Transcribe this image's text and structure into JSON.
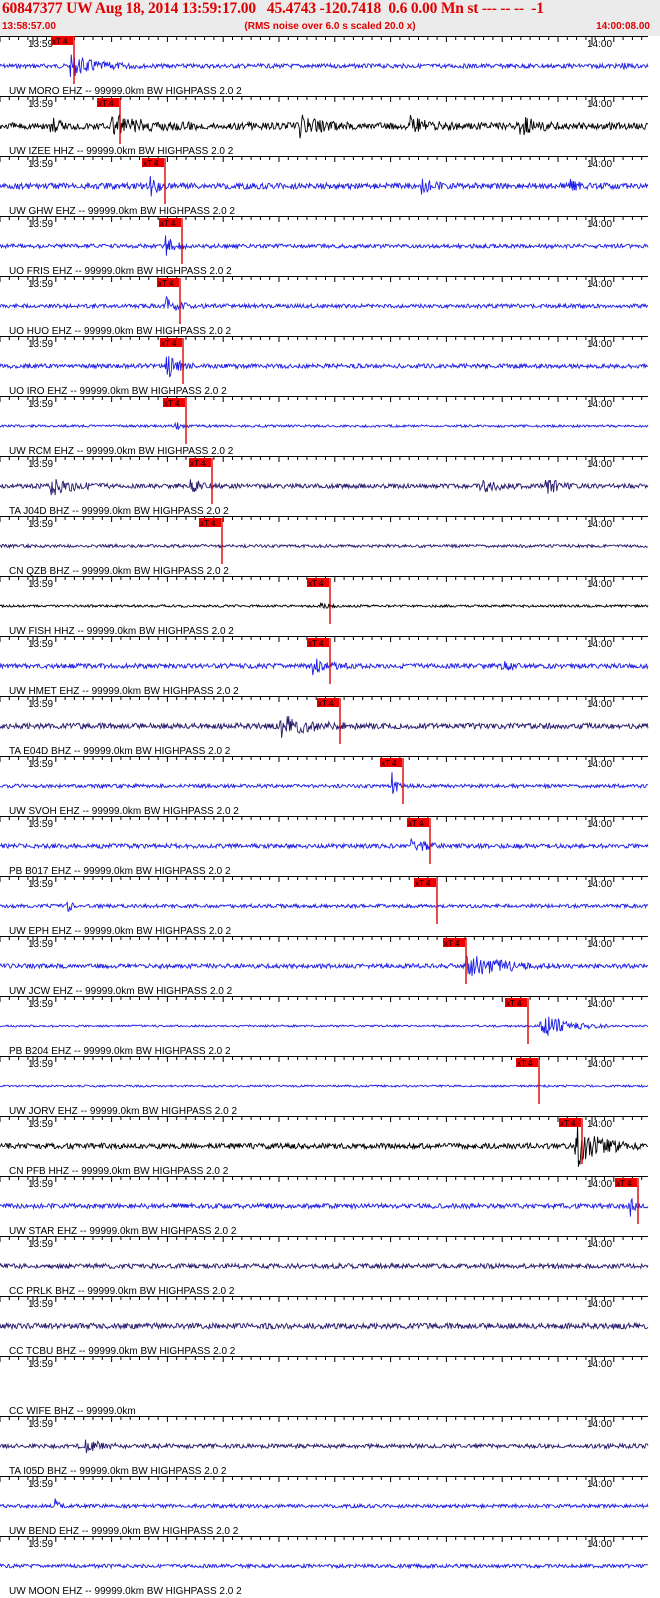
{
  "header": {
    "title": "60847377 UW Aug 18, 2014 13:59:17.00   45.4743 -120.7418  0.6 0.00 Mn st --- -- --  -1",
    "start_time": "13:58:57.00",
    "end_time": "14:00:08.00",
    "rms_note": "(RMS noise over 6.0 s scaled 20.0 x)"
  },
  "tick_labels": {
    "first": "13:59",
    "second": "14:00"
  },
  "pick_label": "xT 4",
  "colors": {
    "blue": "#1e1ee6",
    "black": "#000000",
    "purple": "#2a1a6e",
    "red": "#e00000",
    "pick_bg": "#ee0000"
  },
  "traces": [
    {
      "label": "UW MORO EHZ -- 99999.0km BW  HIGHPASS  2.0  2",
      "color": "blue"
    },
    {
      "label": "UW IZEE HHZ -- 99999.0km BW  HIGHPASS  2.0  2",
      "color": "black"
    },
    {
      "label": "UW GHW EHZ -- 99999.0km BW  HIGHPASS  2.0  2",
      "color": "blue"
    },
    {
      "label": "UO FRIS EHZ -- 99999.0km BW  HIGHPASS  2.0  2",
      "color": "blue"
    },
    {
      "label": "UO HUO EHZ -- 99999.0km BW  HIGHPASS  2.0  2",
      "color": "blue"
    },
    {
      "label": "UO IRO EHZ -- 99999.0km BW  HIGHPASS  2.0  2",
      "color": "blue"
    },
    {
      "label": "UW RCM EHZ -- 99999.0km BW  HIGHPASS  2.0  2",
      "color": "blue"
    },
    {
      "label": "TA J04D BHZ -- 99999.0km BW  HIGHPASS  2.0  2",
      "color": "purple"
    },
    {
      "label": "CN QZB BHZ -- 99999.0km BW  HIGHPASS  2.0  2",
      "color": "purple"
    },
    {
      "label": "UW FISH HHZ -- 99999.0km BW  HIGHPASS  2.0  2",
      "color": "black"
    },
    {
      "label": "UW HMET EHZ -- 99999.0km BW  HIGHPASS  2.0  2",
      "color": "blue"
    },
    {
      "label": "TA E04D BHZ -- 99999.0km BW  HIGHPASS  2.0  2",
      "color": "purple"
    },
    {
      "label": "UW SVOH EHZ -- 99999.0km BW  HIGHPASS  2.0  2",
      "color": "blue"
    },
    {
      "label": "PB B017 EHZ -- 99999.0km BW  HIGHPASS  2.0  2",
      "color": "blue"
    },
    {
      "label": "UW EPH EHZ -- 99999.0km BW  HIGHPASS  2.0  2",
      "color": "blue"
    },
    {
      "label": "UW JCW EHZ -- 99999.0km BW  HIGHPASS  2.0  2",
      "color": "blue"
    },
    {
      "label": "PB B204 EHZ -- 99999.0km BW  HIGHPASS  2.0  2",
      "color": "blue"
    },
    {
      "label": "UW JORV EHZ -- 99999.0km BW  HIGHPASS  2.0  2",
      "color": "blue"
    },
    {
      "label": "CN PFB HHZ -- 99999.0km BW  HIGHPASS  2.0  2",
      "color": "black"
    },
    {
      "label": "UW STAR EHZ -- 99999.0km BW  HIGHPASS  2.0  2",
      "color": "blue"
    },
    {
      "label": "CC PRLK BHZ -- 99999.0km BW  HIGHPASS  2.0  2",
      "color": "purple"
    },
    {
      "label": "CC TCBU BHZ -- 99999.0km BW  HIGHPASS  2.0  2",
      "color": "purple"
    },
    {
      "label": "CC WIFE BHZ -- 99999.0km",
      "color": "none"
    },
    {
      "label": "TA I05D BHZ -- 99999.0km BW  HIGHPASS  2.0  2",
      "color": "purple"
    },
    {
      "label": "UW BEND EHZ -- 99999.0km BW  HIGHPASS  2.0  2",
      "color": "blue"
    },
    {
      "label": "UW MOON EHZ -- 99999.0km BW  HIGHPASS  2.0  2",
      "color": "blue"
    }
  ]
}
